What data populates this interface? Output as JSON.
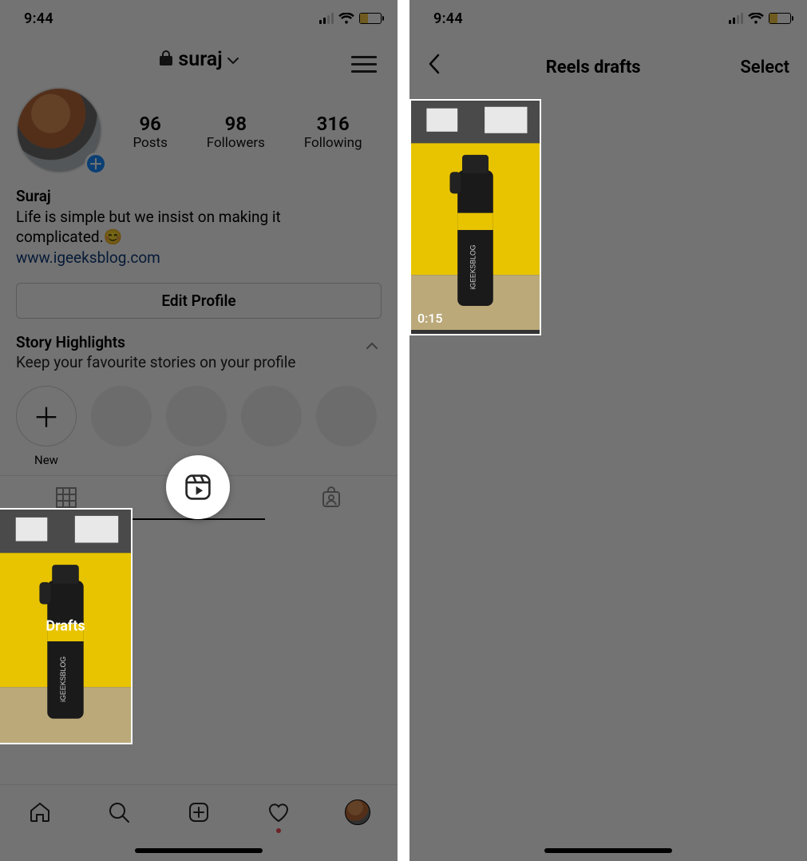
{
  "left": {
    "status": {
      "time": "9:44"
    },
    "header": {
      "username": "suraj"
    },
    "profile": {
      "posts_count": "96",
      "posts_label": "Posts",
      "followers_count": "98",
      "followers_label": "Followers",
      "following_count": "316",
      "following_label": "Following"
    },
    "bio": {
      "display_name": "Suraj",
      "text_line1": "Life is simple but we insist on making it",
      "text_line2": "complicated.",
      "emoji": "😊",
      "link": "www.igeeksblog.com"
    },
    "edit_profile_label": "Edit Profile",
    "highlights": {
      "title": "Story Highlights",
      "subtitle": "Keep your favourite stories on your profile",
      "new_label": "New"
    },
    "drafts_label": "Drafts"
  },
  "right": {
    "status": {
      "time": "9:44"
    },
    "header": {
      "title": "Reels drafts",
      "select_label": "Select"
    },
    "tile": {
      "duration": "0:15"
    }
  }
}
